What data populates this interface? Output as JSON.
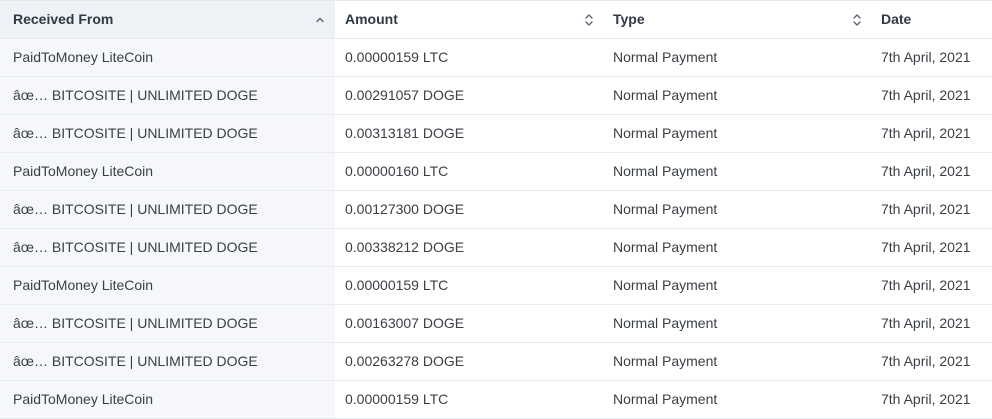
{
  "table": {
    "headers": {
      "received_from": "Received From",
      "amount": "Amount",
      "type": "Type",
      "date": "Date"
    },
    "rows": [
      {
        "received_from": "PaidToMoney LiteCoin",
        "amount": "0.00000159 LTC",
        "type": "Normal Payment",
        "date": "7th April, 2021"
      },
      {
        "received_from": "âœ… BITCOSITE | UNLIMITED DOGE",
        "amount": "0.00291057 DOGE",
        "type": "Normal Payment",
        "date": "7th April, 2021"
      },
      {
        "received_from": "âœ… BITCOSITE | UNLIMITED DOGE",
        "amount": "0.00313181 DOGE",
        "type": "Normal Payment",
        "date": "7th April, 2021"
      },
      {
        "received_from": "PaidToMoney LiteCoin",
        "amount": "0.00000160 LTC",
        "type": "Normal Payment",
        "date": "7th April, 2021"
      },
      {
        "received_from": "âœ… BITCOSITE | UNLIMITED DOGE",
        "amount": "0.00127300 DOGE",
        "type": "Normal Payment",
        "date": "7th April, 2021"
      },
      {
        "received_from": "âœ… BITCOSITE | UNLIMITED DOGE",
        "amount": "0.00338212 DOGE",
        "type": "Normal Payment",
        "date": "7th April, 2021"
      },
      {
        "received_from": "PaidToMoney LiteCoin",
        "amount": "0.00000159 LTC",
        "type": "Normal Payment",
        "date": "7th April, 2021"
      },
      {
        "received_from": "âœ… BITCOSITE | UNLIMITED DOGE",
        "amount": "0.00163007 DOGE",
        "type": "Normal Payment",
        "date": "7th April, 2021"
      },
      {
        "received_from": "âœ… BITCOSITE | UNLIMITED DOGE",
        "amount": "0.00263278 DOGE",
        "type": "Normal Payment",
        "date": "7th April, 2021"
      },
      {
        "received_from": "PaidToMoney LiteCoin",
        "amount": "0.00000159 LTC",
        "type": "Normal Payment",
        "date": "7th April, 2021"
      }
    ]
  },
  "icons": {
    "received_from_sort": "chevron-up-icon",
    "amount_sort": "sort-updown-icon",
    "type_sort": "sort-updown-icon"
  },
  "colors": {
    "sorted_column_bg": "#f5f7fa",
    "header_text": "#2f3a45",
    "body_text": "#3a3f45",
    "row_divider": "#e8ebef"
  }
}
